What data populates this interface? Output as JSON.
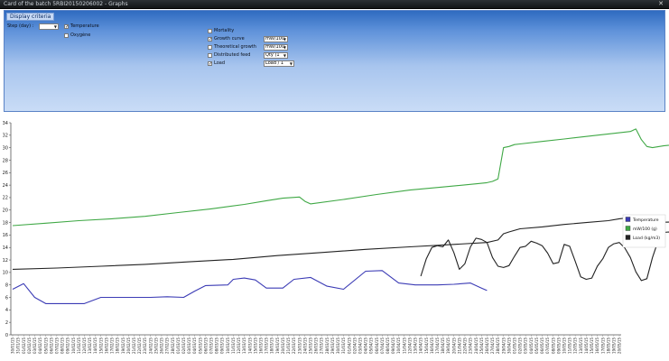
{
  "window": {
    "title": "Card of the batch 5RBI20150206002 - Graphs",
    "close_glyph": "✕"
  },
  "criteria": {
    "header": "Display criteria",
    "step_label": "Step (day) :",
    "step_value": "",
    "temperature": {
      "label": "Temperature",
      "checked": true
    },
    "oxygene": {
      "label": "Oxygène",
      "checked": false
    },
    "mortality": {
      "label": "Mortality",
      "checked": false
    },
    "growth_curve": {
      "label": "Growth curve",
      "checked": true,
      "select": "mW/100"
    },
    "theoretical_growth": {
      "label": "Theoretical growth",
      "checked": false,
      "select": "mW/100"
    },
    "distributed_feed": {
      "label": "Distributed feed",
      "checked": false,
      "select": "Qty (1"
    },
    "load": {
      "label": "Load",
      "checked": true,
      "select": "Load / 1"
    }
  },
  "legend": [
    {
      "label": "Temperature",
      "color": "#3b3bb5"
    },
    {
      "label": "mW/100 (g)",
      "color": "#3fa845"
    },
    {
      "label": "Load (kg/m3)",
      "color": "#222222"
    }
  ],
  "chart_data": {
    "type": "line",
    "ylim": [
      0,
      34
    ],
    "yticks": [
      0,
      2,
      4,
      6,
      8,
      10,
      12,
      14,
      16,
      18,
      20,
      22,
      24,
      26,
      28,
      30,
      32,
      34
    ],
    "x": [
      "30/01/15",
      "31/01/15",
      "01/02/15",
      "02/02/15",
      "03/02/15",
      "04/02/15",
      "05/02/15",
      "06/02/15",
      "07/02/15",
      "08/02/15",
      "09/02/15",
      "10/02/15",
      "11/02/15",
      "12/02/15",
      "13/02/15",
      "14/02/15",
      "15/02/15",
      "16/02/15",
      "17/02/15",
      "18/02/15",
      "19/02/15",
      "20/02/15",
      "21/02/15",
      "22/02/15",
      "23/02/15",
      "24/02/15",
      "25/02/15",
      "26/02/15",
      "27/02/15",
      "28/02/15",
      "01/03/15",
      "02/03/15",
      "03/03/15",
      "04/03/15",
      "05/03/15",
      "06/03/15",
      "07/03/15",
      "08/03/15",
      "09/03/15",
      "10/03/15",
      "11/03/15",
      "12/03/15",
      "13/03/15",
      "14/03/15",
      "15/03/15",
      "16/03/15",
      "17/03/15",
      "18/03/15",
      "19/03/15",
      "20/03/15",
      "21/03/15",
      "22/03/15",
      "23/03/15",
      "24/03/15",
      "25/03/15",
      "26/03/15",
      "27/03/15",
      "28/03/15",
      "29/03/15",
      "30/03/15",
      "31/03/15",
      "01/04/15",
      "02/04/15",
      "03/04/15",
      "04/04/15",
      "05/04/15",
      "06/04/15",
      "07/04/15",
      "08/04/15",
      "09/04/15",
      "10/04/15",
      "11/04/15",
      "12/04/15",
      "13/04/15",
      "14/04/15",
      "15/04/15",
      "16/04/15",
      "17/04/15",
      "18/04/15",
      "19/04/15",
      "20/04/15",
      "21/04/15",
      "22/04/15",
      "23/04/15",
      "24/04/15",
      "25/04/15",
      "26/04/15",
      "27/04/15",
      "28/04/15",
      "29/04/15",
      "30/04/15",
      "01/05/15",
      "02/05/15",
      "03/05/15",
      "04/05/15",
      "05/05/15",
      "06/05/15",
      "07/05/15",
      "08/05/15",
      "09/05/15",
      "10/05/15",
      "11/05/15",
      "12/05/15",
      "13/05/15",
      "14/05/15",
      "15/05/15",
      "16/05/15",
      "17/05/15",
      "18/05/15",
      "19/05/15",
      "20/05/15"
    ],
    "series": [
      {
        "name": "Temperature",
        "color": "#3b3bb5",
        "points": [
          [
            0,
            7.3
          ],
          [
            2,
            8.2
          ],
          [
            4,
            6.0
          ],
          [
            6,
            5.0
          ],
          [
            9,
            5.0
          ],
          [
            13,
            5.0
          ],
          [
            16,
            6.0
          ],
          [
            20,
            6.0
          ],
          [
            25,
            6.0
          ],
          [
            28,
            6.1
          ],
          [
            31,
            6.0
          ],
          [
            33,
            7.0
          ],
          [
            35,
            7.9
          ],
          [
            39,
            8.0
          ],
          [
            40,
            8.9
          ],
          [
            42,
            9.1
          ],
          [
            44,
            8.8
          ],
          [
            46,
            7.5
          ],
          [
            49,
            7.5
          ],
          [
            51,
            8.9
          ],
          [
            54,
            9.2
          ],
          [
            57,
            7.8
          ],
          [
            60,
            7.3
          ],
          [
            64,
            10.2
          ],
          [
            67,
            10.3
          ],
          [
            70,
            8.3
          ],
          [
            73,
            8.0
          ],
          [
            77,
            8.0
          ],
          [
            80,
            8.1
          ],
          [
            83,
            8.3
          ],
          [
            85,
            7.5
          ],
          [
            86,
            7.1
          ]
        ]
      },
      {
        "name": "mW/100 (g)",
        "color": "#3fa845",
        "points": [
          [
            0,
            17.5
          ],
          [
            6,
            17.9
          ],
          [
            12,
            18.3
          ],
          [
            18,
            18.6
          ],
          [
            24,
            19.0
          ],
          [
            30,
            19.6
          ],
          [
            36,
            20.2
          ],
          [
            42,
            20.9
          ],
          [
            46,
            21.5
          ],
          [
            49,
            21.9
          ],
          [
            52,
            22.1
          ],
          [
            53,
            21.4
          ],
          [
            54,
            21.0
          ],
          [
            60,
            21.7
          ],
          [
            66,
            22.5
          ],
          [
            72,
            23.2
          ],
          [
            78,
            23.7
          ],
          [
            84,
            24.2
          ],
          [
            86,
            24.4
          ],
          [
            87,
            24.6
          ],
          [
            88,
            25.0
          ],
          [
            89,
            30.0
          ],
          [
            90,
            30.2
          ],
          [
            91,
            30.5
          ],
          [
            92,
            30.6
          ],
          [
            96,
            31.0
          ],
          [
            100,
            31.4
          ],
          [
            104,
            31.8
          ],
          [
            108,
            32.2
          ],
          [
            112,
            32.6
          ],
          [
            113,
            33.0
          ],
          [
            114,
            31.3
          ],
          [
            115,
            30.2
          ],
          [
            116,
            30.0
          ],
          [
            118,
            30.3
          ],
          [
            122,
            30.7
          ],
          [
            127,
            31.0
          ]
        ]
      },
      {
        "name": "Load (kg/m3)",
        "color": "#222222",
        "points": [
          [
            0,
            10.5
          ],
          [
            8,
            10.7
          ],
          [
            16,
            11.0
          ],
          [
            24,
            11.3
          ],
          [
            32,
            11.7
          ],
          [
            40,
            12.1
          ],
          [
            48,
            12.7
          ],
          [
            56,
            13.2
          ],
          [
            64,
            13.7
          ],
          [
            72,
            14.1
          ],
          [
            80,
            14.5
          ],
          [
            86,
            14.8
          ],
          [
            88,
            15.2
          ],
          [
            89,
            16.2
          ],
          [
            90,
            16.5
          ],
          [
            92,
            17.0
          ],
          [
            96,
            17.3
          ],
          [
            100,
            17.7
          ],
          [
            104,
            18.0
          ],
          [
            108,
            18.3
          ],
          [
            110,
            18.6
          ],
          [
            112,
            18.8
          ],
          [
            114,
            19.1
          ],
          [
            115,
            18.4
          ],
          [
            116,
            18.0
          ],
          [
            120,
            18.1
          ],
          [
            124,
            18.3
          ],
          [
            127,
            18.5
          ]
        ]
      },
      {
        "name": "Load (kg/m3) detail",
        "color": "#222222",
        "points": [
          [
            74,
            9.4
          ],
          [
            75,
            12.2
          ],
          [
            76,
            14.0
          ],
          [
            77,
            14.3
          ],
          [
            78,
            14.1
          ],
          [
            79,
            15.2
          ],
          [
            80,
            13.2
          ],
          [
            81,
            10.5
          ],
          [
            82,
            11.4
          ],
          [
            83,
            14.1
          ],
          [
            84,
            15.5
          ],
          [
            85,
            15.3
          ],
          [
            86,
            14.8
          ],
          [
            87,
            12.4
          ],
          [
            88,
            11.0
          ],
          [
            89,
            10.8
          ],
          [
            90,
            11.1
          ],
          [
            91,
            12.6
          ],
          [
            92,
            14.0
          ],
          [
            93,
            14.2
          ],
          [
            94,
            15.0
          ],
          [
            95,
            14.7
          ],
          [
            96,
            14.3
          ],
          [
            97,
            13.1
          ],
          [
            98,
            11.4
          ],
          [
            99,
            11.6
          ],
          [
            100,
            14.5
          ],
          [
            101,
            14.2
          ],
          [
            102,
            11.8
          ],
          [
            103,
            9.3
          ],
          [
            104,
            8.9
          ],
          [
            105,
            9.1
          ],
          [
            106,
            11.0
          ],
          [
            107,
            12.2
          ],
          [
            108,
            14.0
          ],
          [
            109,
            14.6
          ],
          [
            110,
            14.8
          ],
          [
            111,
            13.9
          ],
          [
            112,
            12.4
          ],
          [
            113,
            10.1
          ],
          [
            114,
            8.7
          ],
          [
            115,
            9.0
          ],
          [
            116,
            12.4
          ],
          [
            117,
            15.0
          ],
          [
            118,
            16.4
          ],
          [
            119,
            16.5
          ],
          [
            120,
            15.0
          ],
          [
            121,
            14.4
          ],
          [
            122,
            13.1
          ],
          [
            123,
            12.7
          ],
          [
            124,
            12.3
          ],
          [
            125,
            12.0
          ],
          [
            126,
            12.0
          ],
          [
            127,
            12.1
          ]
        ]
      }
    ]
  }
}
